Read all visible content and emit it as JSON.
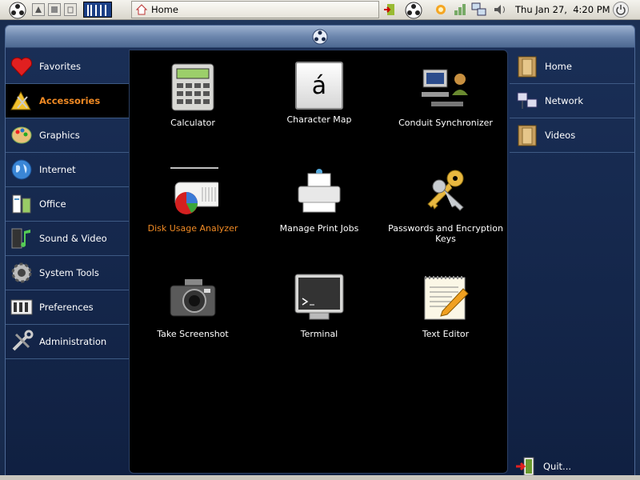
{
  "topbar": {
    "home_button_label": "Home",
    "clock": "Thu Jan 27,  4:20 PM"
  },
  "categories": [
    {
      "label": "Favorites",
      "selected": false
    },
    {
      "label": "Accessories",
      "selected": true
    },
    {
      "label": "Graphics",
      "selected": false
    },
    {
      "label": "Internet",
      "selected": false
    },
    {
      "label": "Office",
      "selected": false
    },
    {
      "label": "Sound & Video",
      "selected": false
    },
    {
      "label": "System Tools",
      "selected": false
    },
    {
      "label": "Preferences",
      "selected": false
    },
    {
      "label": "Administration",
      "selected": false
    }
  ],
  "apps": [
    {
      "label": "Calculator"
    },
    {
      "label": "Character Map",
      "glyph": "á"
    },
    {
      "label": "Conduit Synchronizer"
    },
    {
      "label": "Disk Usage Analyzer",
      "highlighted": true
    },
    {
      "label": "Manage Print Jobs"
    },
    {
      "label": "Passwords and Encryption Keys"
    },
    {
      "label": "Take Screenshot"
    },
    {
      "label": "Terminal"
    },
    {
      "label": "Text Editor"
    }
  ],
  "places": [
    {
      "label": "Home"
    },
    {
      "label": "Network"
    },
    {
      "label": "Videos"
    }
  ],
  "quit_label": "Quit...",
  "colors": {
    "accent": "#f08a24",
    "panel_bg": "#000000",
    "launcher_bg": "#1a2f57"
  }
}
